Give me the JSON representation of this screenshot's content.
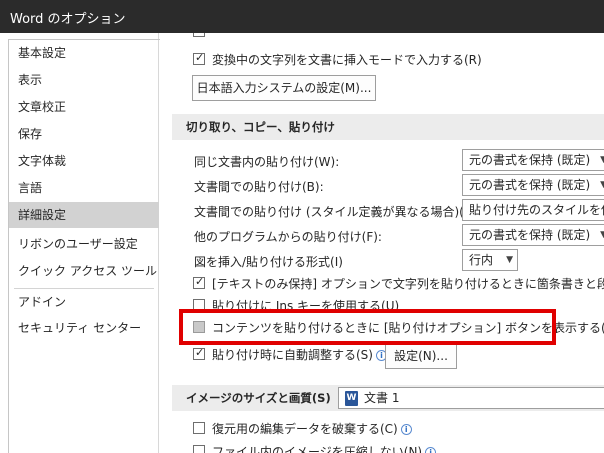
{
  "window": {
    "title": "Word のオプション"
  },
  "sidebar": {
    "items": [
      {
        "label": "基本設定"
      },
      {
        "label": "表示"
      },
      {
        "label": "文章校正"
      },
      {
        "label": "保存"
      },
      {
        "label": "文字体裁"
      },
      {
        "label": "言語"
      },
      {
        "label": "詳細設定",
        "selected": true
      },
      {
        "label": "リボンのユーザー設定"
      },
      {
        "label": "クイック アクセス ツール バー"
      },
      {
        "label": "アドイン"
      },
      {
        "label": "セキュリティ センター"
      }
    ]
  },
  "ime": {
    "insert_mode_label": "変換中の文字列を文書に挿入モードで入力する(R)",
    "insert_mode_checked": true,
    "ime_settings_button": "日本語入力システムの設定(M)..."
  },
  "cut_copy_paste": {
    "heading": "切り取り、コピー、貼り付け",
    "rows": [
      {
        "label": "同じ文書内の貼り付け(W):",
        "value": "元の書式を保持 (既定)"
      },
      {
        "label": "文書間での貼り付け(B):",
        "value": "元の書式を保持 (既定)"
      },
      {
        "label": "文書間での貼り付け (スタイル定義が異なる場合)(E):",
        "value": "貼り付け先のスタイルを使用"
      },
      {
        "label": "他のプログラムからの貼り付け(F):",
        "value": "元の書式を保持 (既定)"
      }
    ],
    "picture_label": "図を挿入/貼り付ける形式(I)",
    "picture_value": "行内",
    "text_only_label": "[テキストのみ保持] オプションで文字列を貼り付けるときに箇条書きと段落番号を保",
    "text_only_checked": true,
    "ins_key_label": "貼り付けに Ins キーを使用する(U)",
    "ins_key_checked": false,
    "show_paste_options_label": "コンテンツを貼り付けるときに [貼り付けオプション] ボタンを表示する(O)",
    "show_paste_options_checked": false,
    "smart_cut_label": "貼り付け時に自動調整する(S)",
    "smart_cut_checked": true,
    "smart_cut_settings_button": "設定(N)..."
  },
  "image_size": {
    "heading": "イメージのサイズと画質(S)",
    "document": "文書 1",
    "discard_editing_label": "復元用の編集データを破棄する(C)",
    "discard_editing_checked": false,
    "no_compress_label": "ファイル内のイメージを圧縮しない(N)",
    "no_compress_checked": false
  },
  "colors": {
    "highlight": "#e00000",
    "selected_nav": "#d2d2d2",
    "section_bg": "#ececec",
    "titlebar": "#2b2b2b"
  }
}
